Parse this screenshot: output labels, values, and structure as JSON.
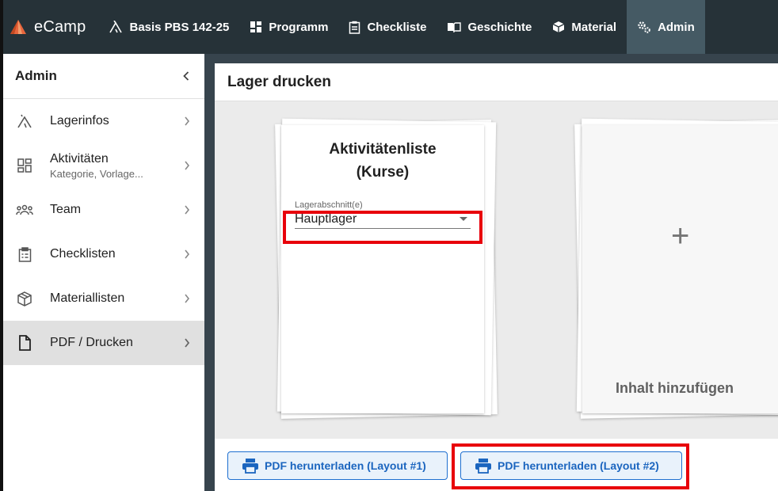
{
  "app": {
    "brand": "eCamp"
  },
  "topnav": {
    "camp": "Basis PBS 142-25",
    "items": [
      {
        "label": "Programm",
        "icon": "grid-icon"
      },
      {
        "label": "Checkliste",
        "icon": "clipboard-icon"
      },
      {
        "label": "Geschichte",
        "icon": "book-icon"
      },
      {
        "label": "Material",
        "icon": "box-icon"
      },
      {
        "label": "Admin",
        "icon": "gears-icon",
        "active": true
      }
    ]
  },
  "sidebar": {
    "title": "Admin",
    "items": [
      {
        "label": "Lagerinfos",
        "sub": "",
        "icon": "tent-icon"
      },
      {
        "label": "Aktivitäten",
        "sub": "Kategorie, Vorlage...",
        "icon": "dashboard-icon"
      },
      {
        "label": "Team",
        "sub": "",
        "icon": "team-icon"
      },
      {
        "label": "Checklisten",
        "sub": "",
        "icon": "clipboard-icon"
      },
      {
        "label": "Materiallisten",
        "sub": "",
        "icon": "box-icon"
      },
      {
        "label": "PDF / Drucken",
        "sub": "",
        "icon": "file-icon",
        "active": true
      }
    ]
  },
  "main": {
    "title": "Lager drucken",
    "card1": {
      "title_line1": "Aktivitätenliste",
      "title_line2": "(Kurse)",
      "field_label": "Lagerabschnitt(e)",
      "field_value": "Hauptlager"
    },
    "card2": {
      "plus": "+",
      "label": "Inhalt hinzufügen"
    },
    "buttons": {
      "layout1": "PDF herunterladen (Layout #1)",
      "layout2": "PDF herunterladen (Layout #2)"
    }
  },
  "colors": {
    "topbar": "#263238",
    "active_nav": "#455a64",
    "accent": "#1b65bf",
    "highlight": "#e8000b"
  }
}
